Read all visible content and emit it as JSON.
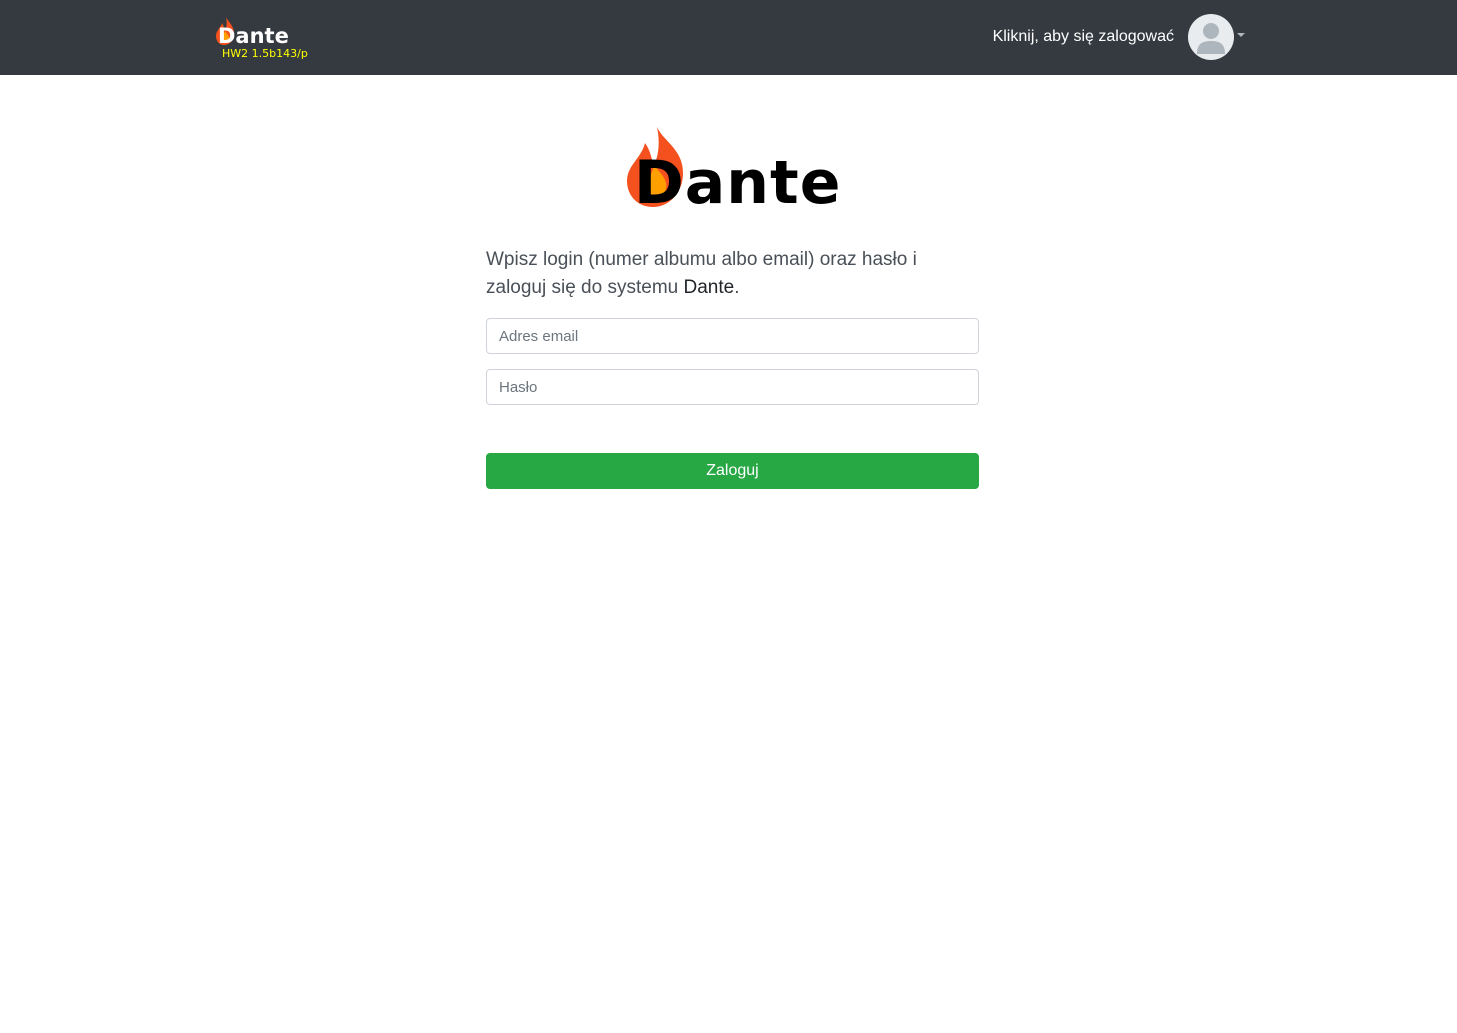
{
  "navbar": {
    "brand_name": "Dante",
    "version": "HW2 1.5b143/p",
    "login_link": "Kliknij, aby się zalogować",
    "avatar_icon": "user-avatar-icon",
    "dropdown_icon": "caret-down-icon"
  },
  "logo": {
    "text": "Dante",
    "icon": "flame-icon"
  },
  "intro": {
    "line_start": "Wpisz login (numer albumu albo email) oraz hasło i zaloguj się do systemu ",
    "system_name": "Dante",
    "line_end": "."
  },
  "form": {
    "email_placeholder": "Adres email",
    "email_value": "",
    "password_placeholder": "Hasło",
    "password_value": "",
    "submit_label": "Zaloguj"
  },
  "colors": {
    "navbar_bg": "#343a40",
    "version_color": "#ffff00",
    "button_bg": "#28a745",
    "flame_outer": "#f4511e",
    "flame_inner": "#ffa000"
  }
}
